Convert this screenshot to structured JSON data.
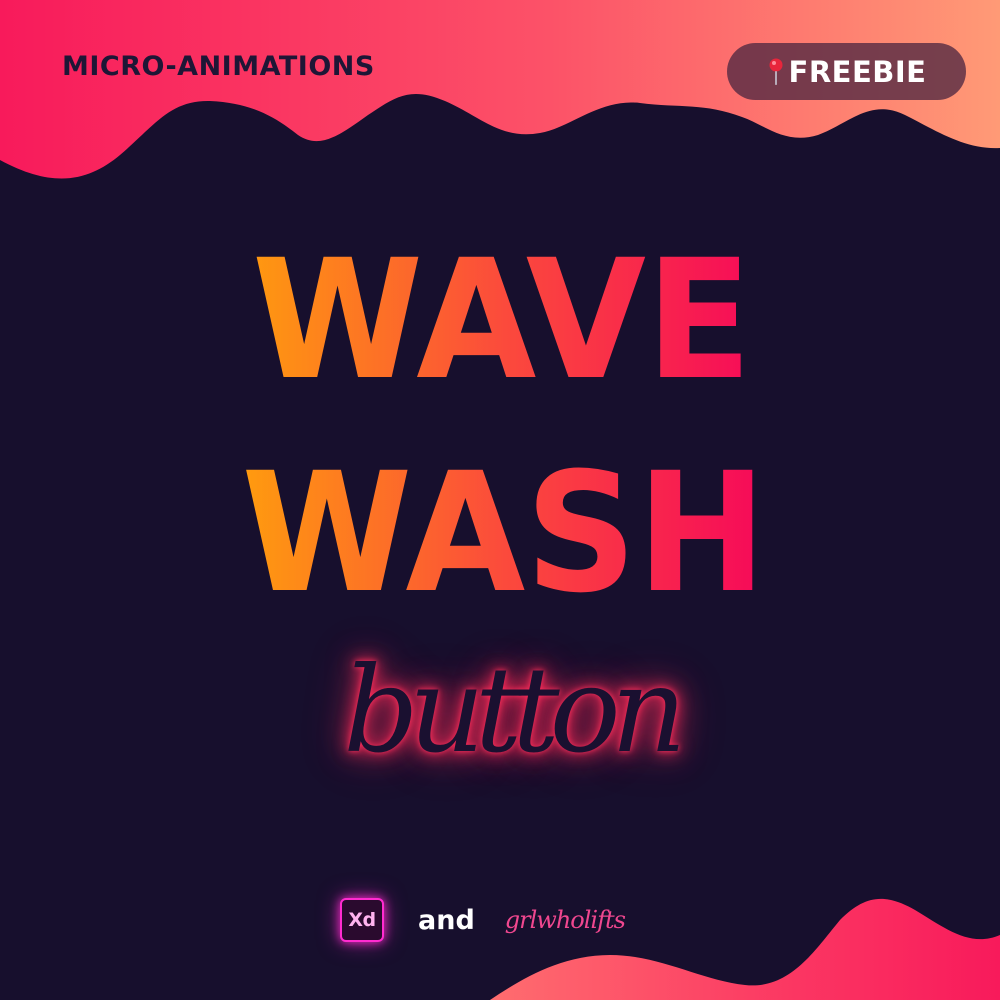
{
  "poster": {
    "category": "MICRO-ANIMATIONS",
    "badge": {
      "icon": "pushpin-icon",
      "label": "FREEBIE"
    },
    "title": {
      "line1": "WAVE",
      "line2": "WASH"
    },
    "subtitle": "button",
    "credits": {
      "tool_badge": "Xd",
      "tool_icon": "adobe-xd-icon",
      "connector": "and",
      "author": "grlwholifts"
    }
  },
  "colors": {
    "background": "#170f2d",
    "wave_gradient_start": "#f81a5b",
    "wave_gradient_end": "#ff9a76",
    "title_gradient_start": "#ff9c0e",
    "title_gradient_end": "#f6085a",
    "glow": "#ff2d5a",
    "xd_accent": "#ff2bd0",
    "author_color": "#f0478f"
  }
}
